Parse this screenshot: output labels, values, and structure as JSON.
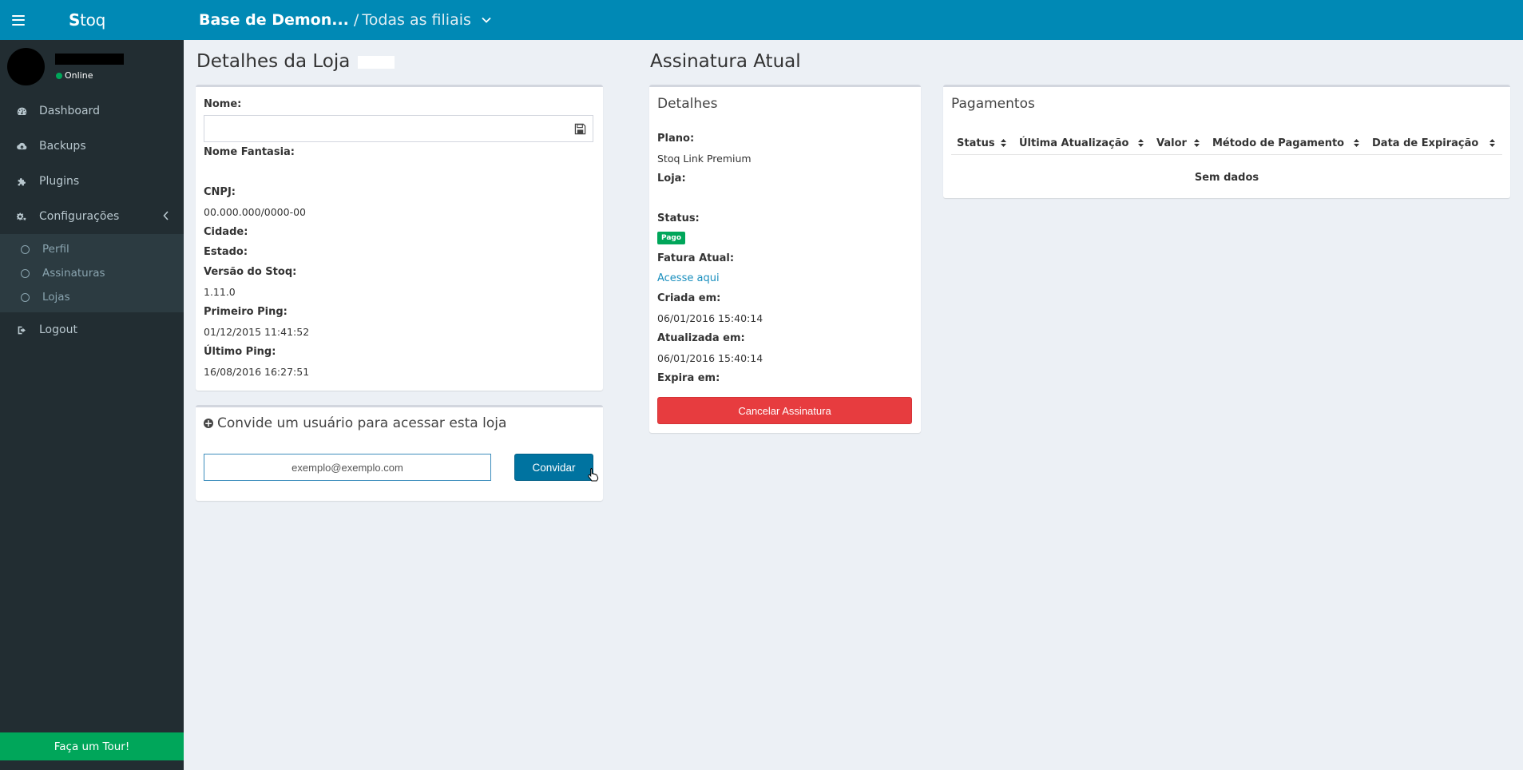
{
  "app": {
    "logo_s": "S",
    "logo_rest": "toq"
  },
  "user": {
    "status": "Online"
  },
  "nav": {
    "items": [
      {
        "label": "Dashboard",
        "icon": "dashboard-icon"
      },
      {
        "label": "Backups",
        "icon": "cloud-upload-icon"
      },
      {
        "label": "Plugins",
        "icon": "puzzle-icon"
      },
      {
        "label": "Configurações",
        "icon": "gears-icon"
      }
    ],
    "sub_items": [
      {
        "label": "Perfil"
      },
      {
        "label": "Assinaturas"
      },
      {
        "label": "Lojas"
      }
    ],
    "logout": "Logout",
    "tour": "Faça um Tour!"
  },
  "topbar": {
    "store": "Base de Demon...",
    "separator": "/",
    "branch": "Todas as filiais"
  },
  "store_details": {
    "heading": "Detalhes da Loja",
    "nome_label": "Nome:",
    "nome_value": "",
    "fantasia_label": "Nome Fantasia:",
    "cnpj_label": "CNPJ:",
    "cnpj_value": "00.000.000/0000-00",
    "cidade_label": "Cidade:",
    "estado_label": "Estado:",
    "versao_label": "Versão do Stoq:",
    "versao_value": "1.11.0",
    "primeiro_label": "Primeiro Ping:",
    "primeiro_value": "01/12/2015 11:41:52",
    "ultimo_label": "Último Ping:",
    "ultimo_value": "16/08/2016 16:27:51"
  },
  "invite": {
    "title": "Convide um usuário para acessar esta loja",
    "email_value": "exemplo@exemplo.com",
    "button": "Convidar"
  },
  "subscription": {
    "heading": "Assinatura Atual",
    "box_title": "Detalhes",
    "plano_label": "Plano:",
    "plano_value": "Stoq Link Premium",
    "loja_label": "Loja:",
    "status_label": "Status:",
    "status_badge": "Pago",
    "fatura_label": "Fatura Atual:",
    "fatura_link": "Acesse aqui",
    "criada_label": "Criada em:",
    "criada_value": "06/01/2016 15:40:14",
    "atualizada_label": "Atualizada em:",
    "atualizada_value": "06/01/2016 15:40:14",
    "expira_label": "Expira em:",
    "cancel_button": "Cancelar Assinatura"
  },
  "payments": {
    "title": "Pagamentos",
    "columns": [
      "Status",
      "Última Atualização",
      "Valor",
      "Método de Pagamento",
      "Data de Expiração"
    ],
    "empty": "Sem dados"
  },
  "colors": {
    "brand": "#0089b5",
    "sidebar": "#222d32",
    "success": "#00a65a",
    "danger": "#e73c3f"
  }
}
